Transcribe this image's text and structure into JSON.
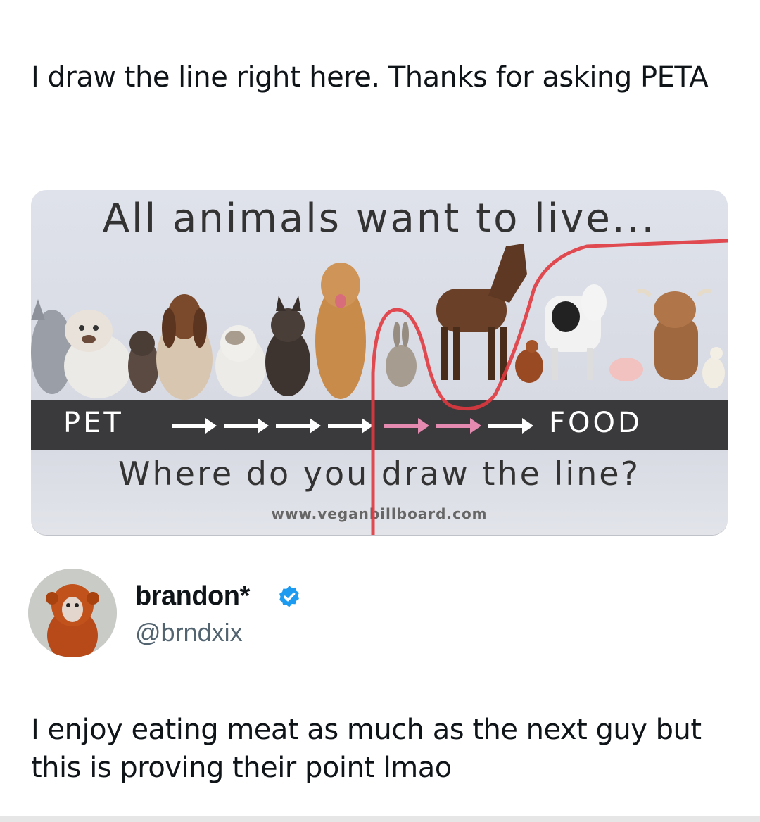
{
  "caption": "I draw the line right here. Thanks for asking PETA",
  "billboard": {
    "headline": "All animals want to live...",
    "bar_left": "PET",
    "bar_right": "FOOD",
    "question": "Where do you draw the line?",
    "url": "www.veganbillboard.com",
    "bar_color": "#3a3a3c",
    "drawn_line_color": "#e0393e",
    "animals": [
      "cat",
      "bulldog",
      "kitten",
      "basset-hound",
      "persian-cat",
      "french-bulldog",
      "golden-retriever",
      "rabbit",
      "horse",
      "chicken",
      "cow",
      "pig",
      "highland-cow",
      "duck"
    ]
  },
  "author": {
    "display_name": "brandon*",
    "handle": "@brndxix",
    "verified": true,
    "accent": "#1d9bf0"
  },
  "tweet": {
    "text": "I enjoy eating meat as much as the next guy but this is proving their point lmao"
  }
}
